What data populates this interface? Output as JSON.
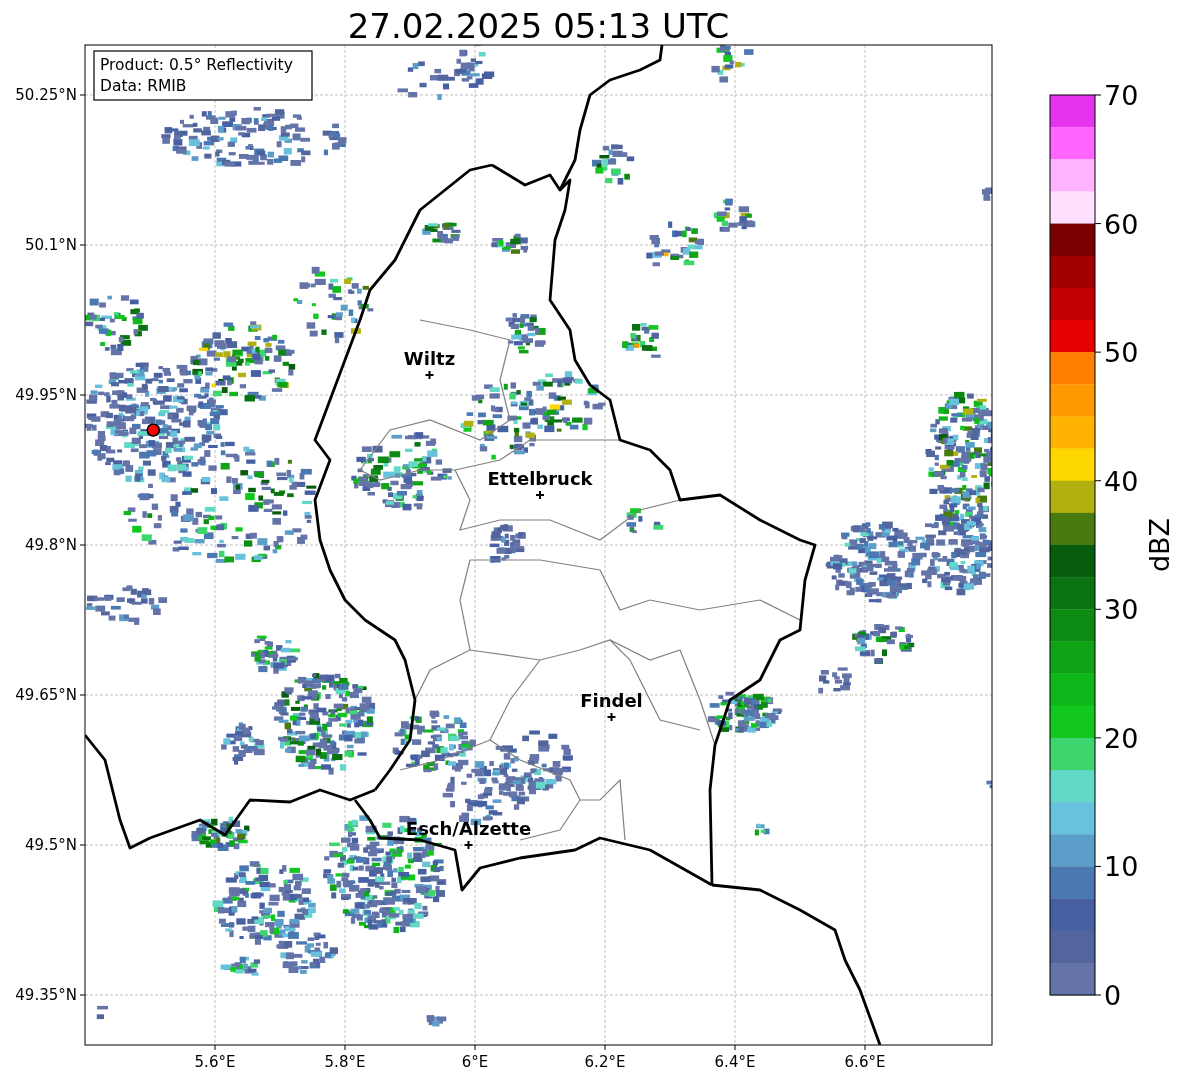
{
  "title": "27.02.2025 05:13 UTC",
  "info_box": [
    "Product: 0.5° Reflectivity",
    "Data: RMIB"
  ],
  "map": {
    "xticks": [
      "5.6°E",
      "5.8°E",
      "6°E",
      "6.2°E",
      "6.4°E",
      "6.6°E"
    ],
    "yticks": [
      "50.25°N",
      "50.1°N",
      "49.95°N",
      "49.8°N",
      "49.65°N",
      "49.5°N",
      "49.35°N"
    ],
    "cities": [
      {
        "name": "Wiltz"
      },
      {
        "name": "Ettelbruck"
      },
      {
        "name": "Findel"
      },
      {
        "name": "Esch/Alzette"
      }
    ]
  },
  "colorbar": {
    "label": "dBZ",
    "ticks": [
      "70",
      "60",
      "50",
      "40",
      "30",
      "20",
      "10",
      "0"
    ],
    "segments": [
      {
        "color": "#e633ee"
      },
      {
        "color": "#ff66ff"
      },
      {
        "color": "#ffb3ff"
      },
      {
        "color": "#ffe0ff"
      },
      {
        "color": "#7a0000"
      },
      {
        "color": "#a00000"
      },
      {
        "color": "#c00000"
      },
      {
        "color": "#e60000"
      },
      {
        "color": "#ff7f00"
      },
      {
        "color": "#ff9900"
      },
      {
        "color": "#ffb300"
      },
      {
        "color": "#ffd700"
      },
      {
        "color": "#b0b010"
      },
      {
        "color": "#487a10"
      },
      {
        "color": "#085c0d"
      },
      {
        "color": "#0a7210"
      },
      {
        "color": "#0c8a12"
      },
      {
        "color": "#0fa315"
      },
      {
        "color": "#10b71a"
      },
      {
        "color": "#12c81e"
      },
      {
        "color": "#3dd66e"
      },
      {
        "color": "#62d8c6"
      },
      {
        "color": "#66c2dd"
      },
      {
        "color": "#5b9ec9"
      },
      {
        "color": "#4a78b0"
      },
      {
        "color": "#4760a3"
      },
      {
        "color": "#53659d"
      },
      {
        "color": "#6574a8"
      }
    ]
  }
}
